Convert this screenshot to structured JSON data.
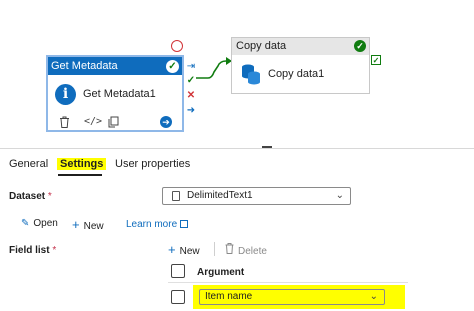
{
  "canvas": {
    "get_metadata": {
      "header_title": "Get Metadata",
      "activity_name": "Get Metadata1"
    },
    "copy_data": {
      "header_title": "Copy data",
      "activity_name": "Copy data1"
    },
    "colors": {
      "activity_header": "#0f6cbd",
      "success": "#107c10",
      "failure": "#d13438",
      "highlight": "#ffff00"
    },
    "icons": {
      "status": "check-circle-icon",
      "activity": "info-icon",
      "copy": "database-copy-icon",
      "delete": "trash-icon",
      "code": "code-icon",
      "clone": "copy-icon",
      "go": "arrow-right-circle-icon"
    }
  },
  "tabs": {
    "general": "General",
    "settings": "Settings",
    "user_properties": "User properties",
    "selected": "Settings"
  },
  "dataset": {
    "label": "Dataset",
    "required_mark": "*",
    "value": "DelimitedText1",
    "open_label": "Open",
    "new_label": "New",
    "learn_more_label": "Learn more"
  },
  "field_list": {
    "label": "Field list",
    "required_mark": "*",
    "new_label": "New",
    "delete_label": "Delete",
    "column_header": "Argument",
    "rows": [
      {
        "argument": "Item name"
      }
    ]
  }
}
